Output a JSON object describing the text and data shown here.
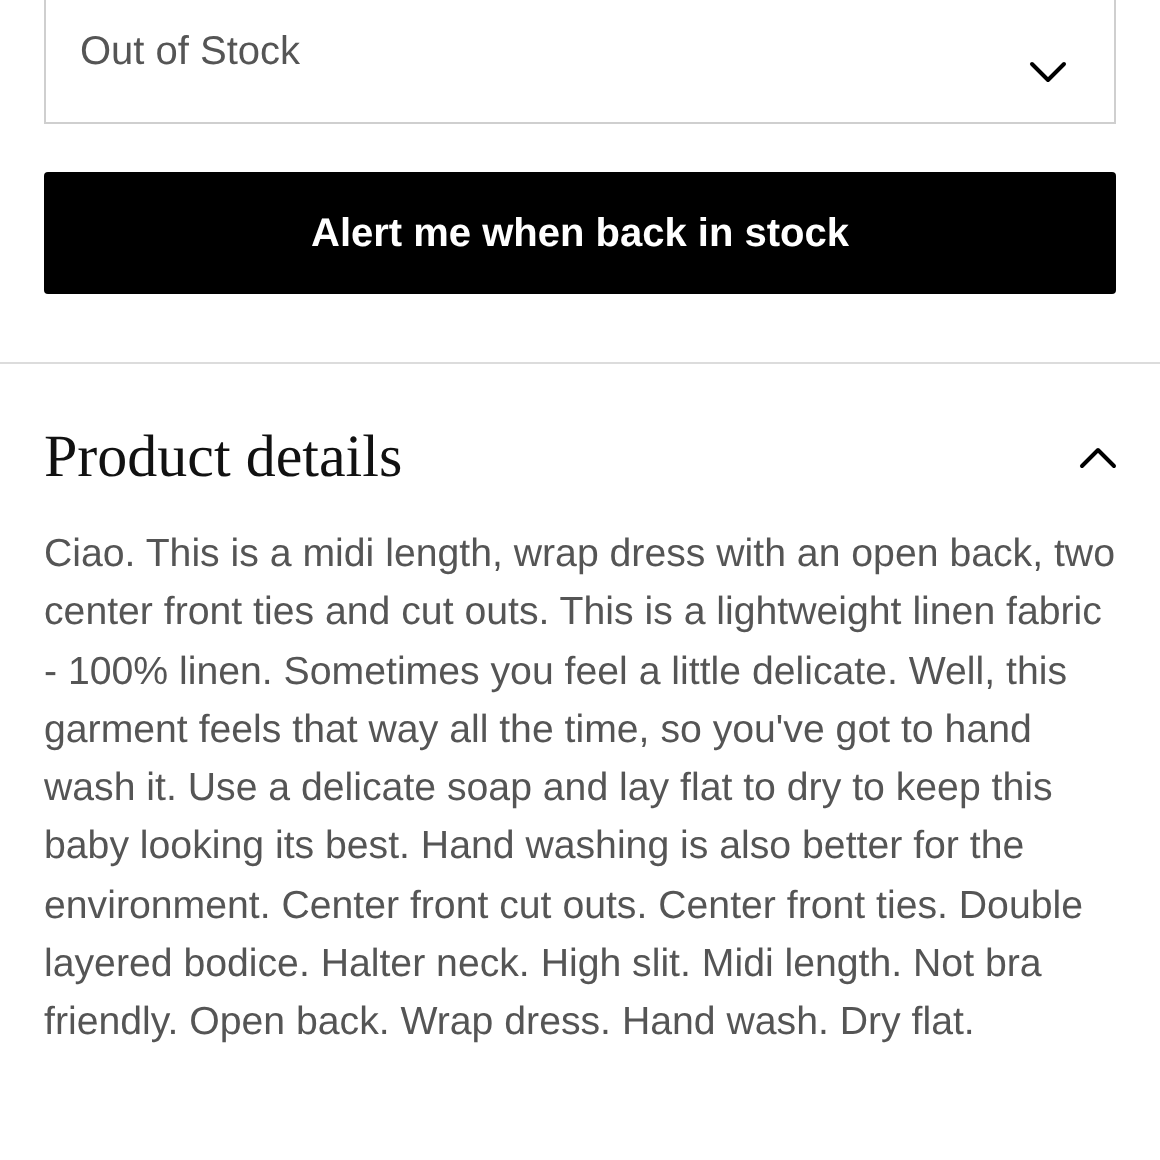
{
  "select": {
    "value": "Out of Stock"
  },
  "button": {
    "label": "Alert me when back in stock"
  },
  "details": {
    "title": "Product details",
    "expanded": true,
    "text": "Ciao. This is a midi length, wrap dress with an open back, two center front ties and cut outs. This is a lightweight linen fabric - 100% linen. Sometimes you feel a little delicate. Well, this garment feels that way all the time, so you've got to hand wash it. Use a delicate soap and lay flat to dry to keep this baby looking its best. Hand washing is also better for the environment. Center front cut outs. Center front ties. Double layered bodice. Halter neck. High slit. Midi length. Not bra friendly. Open back. Wrap dress. Hand wash. Dry flat."
  }
}
